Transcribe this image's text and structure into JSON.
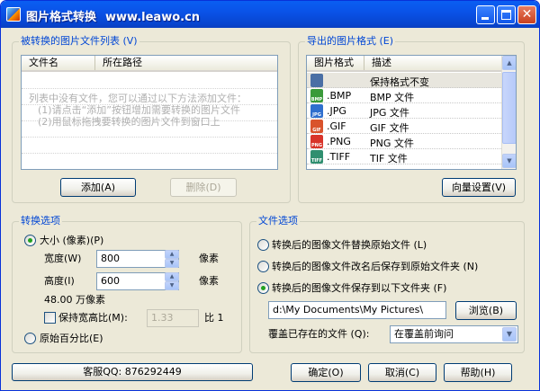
{
  "window": {
    "title": "图片格式转换",
    "site": "www.leawo.cn",
    "close_glyph": "✕"
  },
  "source_list": {
    "group_title": "被转换的图片文件列表 (V)",
    "columns": [
      "文件名",
      "所在路径"
    ],
    "hint_lines": [
      "列表中没有文件，您可以通过以下方法添加文件：",
      "(1)请点击“添加”按钮增加需要转换的图片文件",
      "(2)用鼠标拖拽要转换的图片文件到窗口上"
    ],
    "add_button": "添加(A)",
    "delete_button": "删除(D)"
  },
  "export_formats": {
    "group_title": "导出的图片格式 (E)",
    "columns": [
      "图片格式",
      "描述"
    ],
    "rows": [
      {
        "ext": "",
        "desc": "保持格式不变",
        "icon": "keep-format-icon",
        "color": "#4a6fa5",
        "tag": ""
      },
      {
        "ext": ".BMP",
        "desc": "BMP 文件",
        "icon": "bmp-file-icon",
        "color": "#3a9a3a",
        "tag": "BMP"
      },
      {
        "ext": ".JPG",
        "desc": "JPG 文件",
        "icon": "jpg-file-icon",
        "color": "#2f6fce",
        "tag": "JPG"
      },
      {
        "ext": ".GIF",
        "desc": "GIF 文件",
        "icon": "gif-file-icon",
        "color": "#d9532c",
        "tag": "GIF"
      },
      {
        "ext": ".PNG",
        "desc": "PNG 文件",
        "icon": "png-file-icon",
        "color": "#d8342a",
        "tag": "PNG"
      },
      {
        "ext": ".TIFF",
        "desc": "TIF 文件",
        "icon": "tiff-file-icon",
        "color": "#2f8f6f",
        "tag": "TIFF"
      }
    ],
    "wizard_button": "向量设置(V)"
  },
  "convert_options": {
    "group_title": "转换选项",
    "size_radio": "大小 (像素)(P)",
    "width_label": "宽度(W)",
    "width_value": "800",
    "height_label": "高度(I)",
    "height_value": "600",
    "unit": "像素",
    "megapixels": "48.00 万像素",
    "keep_ratio_label": "保持宽高比(M):",
    "ratio_value": "1.33",
    "ratio_suffix": "比 1",
    "percent_radio": "原始百分比(E)"
  },
  "file_options": {
    "group_title": "文件选项",
    "option_replace": "转换后的图像文件替换原始文件 (L)",
    "option_rename": "转换后的图像文件改名后保存到原始文件夹 (N)",
    "option_folder": "转换后的图像文件保存到以下文件夹 (F)",
    "folder_path": "d:\\My Documents\\My Pictures\\",
    "browse_button": "浏览(B)",
    "overwrite_label": "覆盖已存在的文件 (Q):",
    "overwrite_value": "在覆盖前询问"
  },
  "footer": {
    "support_button": "客服QQ: 876292449",
    "ok_button": "确定(O)",
    "cancel_button": "取消(C)",
    "help_button": "帮助(H)"
  },
  "colors": {
    "accent": "#0046d5",
    "titlebar": "#0a53e8",
    "close": "#c8401f"
  }
}
